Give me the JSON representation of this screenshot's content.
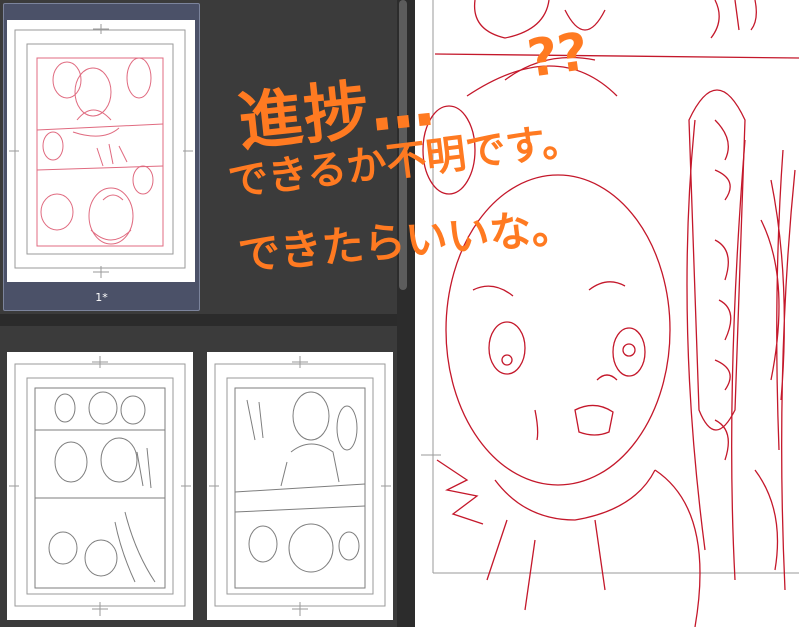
{
  "page_manager": {
    "pages": [
      {
        "label": "1*",
        "selected": true
      },
      {
        "label": "",
        "selected": false
      },
      {
        "label": "",
        "selected": false
      }
    ],
    "sketch_colors": {
      "page1": "#e06b80",
      "page2": "#8a8a8a",
      "page3": "#8a8a8a"
    }
  },
  "canvas": {
    "sketch_color": "#c4182b",
    "background": "#ffffff"
  },
  "note": {
    "color": "#ff7a21",
    "title": "進捗…",
    "marks": "??",
    "line1": "できるか不明です。",
    "line2": "できたらいいな。"
  }
}
